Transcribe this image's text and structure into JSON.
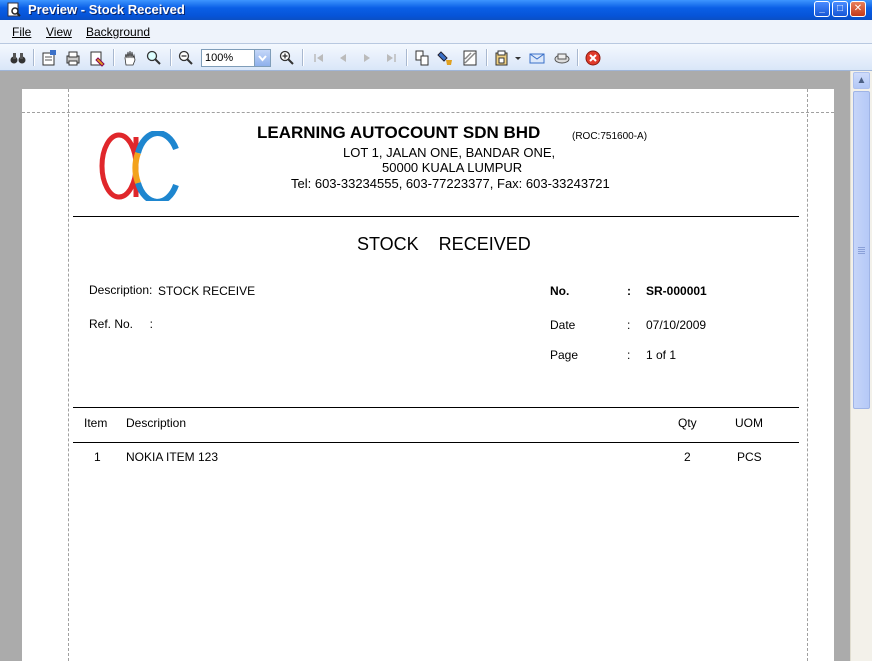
{
  "window": {
    "title": "Preview - Stock Received"
  },
  "menu": {
    "file": "File",
    "view": "View",
    "background": "Background"
  },
  "toolbar": {
    "zoom": "100%"
  },
  "company": {
    "name": "LEARNING AUTOCOUNT SDN BHD",
    "roc": "(ROC:751600-A)",
    "address1": "LOT 1, JALAN ONE,  BANDAR ONE,",
    "address2": "50000  KUALA LUMPUR",
    "contact": "Tel:  603-33234555,  603-77223377,  Fax: 603-33243721"
  },
  "document": {
    "title": "STOCK    RECEIVED",
    "description_label": "Description:",
    "description_value": "STOCK RECEIVE",
    "refno_label": "Ref. No.     :",
    "no_label": "No.",
    "no_value": "SR-000001",
    "date_label": "Date",
    "date_value": "07/10/2009",
    "page_label": "Page",
    "page_value": "1 of 1",
    "colon": ":"
  },
  "table": {
    "headers": {
      "item": "Item",
      "description": "Description",
      "qty": "Qty",
      "uom": "UOM"
    },
    "rows": [
      {
        "item": "1",
        "description": "NOKIA ITEM 123",
        "qty": "2",
        "uom": "PCS"
      }
    ]
  },
  "colors": {
    "titlebar": "#0654d8",
    "logo_red": "#e0272b",
    "logo_orange": "#f3a21c",
    "logo_blue": "#1e86cf"
  }
}
